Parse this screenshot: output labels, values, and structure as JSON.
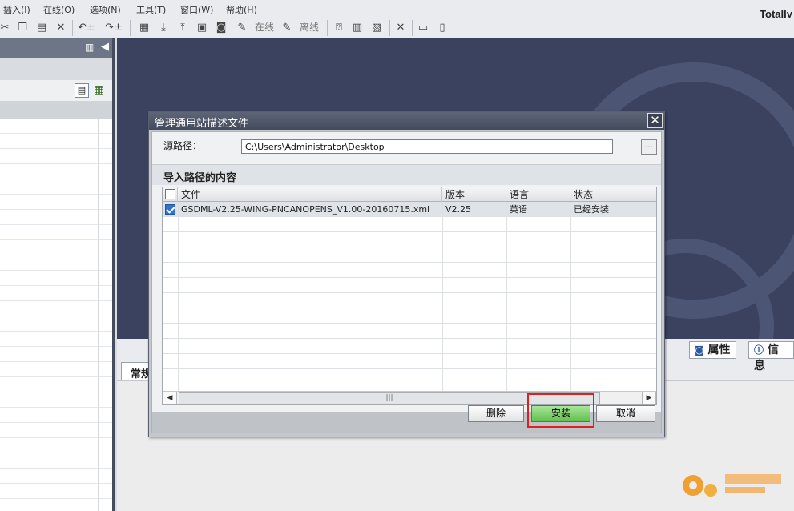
{
  "menu": {
    "items": [
      "插入(I)",
      "在线(O)",
      "选项(N)",
      "工具(T)",
      "窗口(W)",
      "帮助(H)"
    ],
    "brand": "Totally"
  },
  "toolbar": {
    "online": "在线",
    "offline": "离线"
  },
  "lower_panel": {
    "properties_tab": "属性",
    "info_tab": "信息",
    "general_tab": "常规"
  },
  "dialog": {
    "title": "管理通用站描述文件",
    "source_label": "源路径：",
    "source_value": "C:\\Users\\Administrator\\Desktop",
    "browse_label": "...",
    "section_title": "导入路径的内容",
    "columns": [
      "文件",
      "版本",
      "语言",
      "状态"
    ],
    "rows": [
      {
        "checked": true,
        "file": "GSDML-V2.25-WING-PNCANOPENS_V1.00-20160715.xml",
        "version": "V2.25",
        "language": "英语",
        "status": "已经安装"
      }
    ],
    "buttons": {
      "delete": "删除",
      "install": "安装",
      "cancel": "取消"
    },
    "close": "✕"
  },
  "colors": {
    "highlight": "#e02020",
    "install_btn": "#63c04e",
    "workspace_bg": "#3a4260"
  }
}
